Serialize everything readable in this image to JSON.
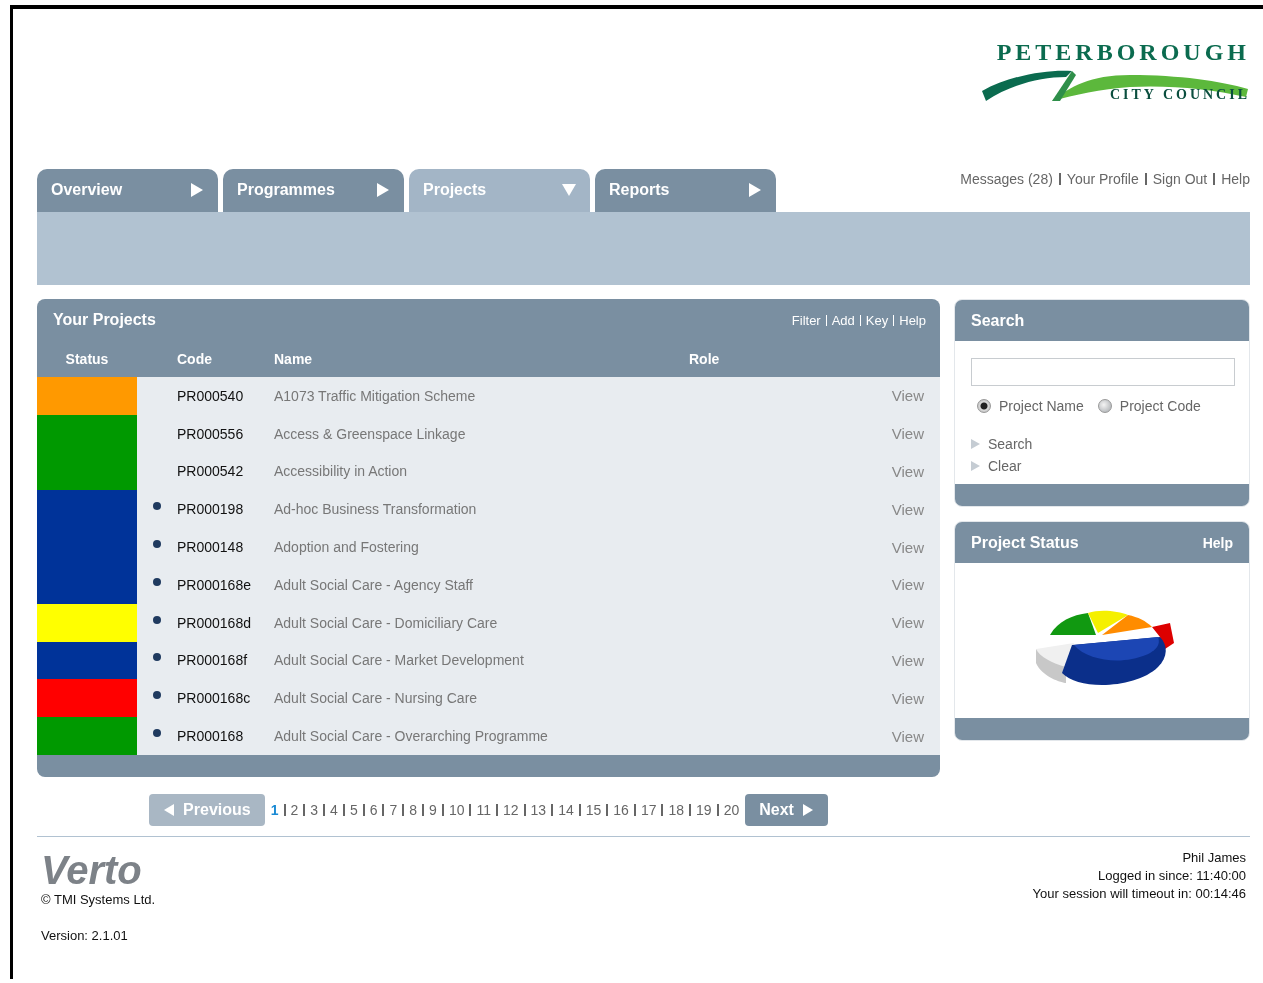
{
  "logo": {
    "title": "PETERBOROUGH",
    "subtitle": "CITY COUNCIL"
  },
  "tabs": [
    {
      "label": "Overview",
      "selected": false
    },
    {
      "label": "Programmes",
      "selected": false
    },
    {
      "label": "Projects",
      "selected": true
    },
    {
      "label": "Reports",
      "selected": false
    }
  ],
  "user_links": [
    "Messages (28)",
    "Your Profile",
    "Sign Out",
    "Help"
  ],
  "projects": {
    "title": "Your Projects",
    "actions": [
      "Filter",
      "Add",
      "Key",
      "Help"
    ],
    "columns": [
      "Status",
      "Code",
      "Name",
      "Role"
    ],
    "rows": [
      {
        "color": "#ff9900",
        "flagged": false,
        "code": "PR000540",
        "name": "A1073 Traffic Mitigation Scheme",
        "action": "View"
      },
      {
        "color": "#009900",
        "flagged": false,
        "code": "PR000556",
        "name": "Access & Greenspace Linkage",
        "action": "View"
      },
      {
        "color": "#009900",
        "flagged": false,
        "code": "PR000542",
        "name": "Accessibility in Action",
        "action": "View"
      },
      {
        "color": "#003399",
        "flagged": true,
        "code": "PR000198",
        "name": "Ad-hoc Business Transformation",
        "action": "View"
      },
      {
        "color": "#003399",
        "flagged": true,
        "code": "PR000148",
        "name": "Adoption and Fostering",
        "action": "View"
      },
      {
        "color": "#003399",
        "flagged": true,
        "code": "PR000168e",
        "name": "Adult Social Care - Agency Staff",
        "action": "View"
      },
      {
        "color": "#ffff00",
        "flagged": true,
        "code": "PR000168d",
        "name": "Adult Social Care - Domiciliary Care",
        "action": "View"
      },
      {
        "color": "#003399",
        "flagged": true,
        "code": "PR000168f",
        "name": "Adult Social Care - Market Development",
        "action": "View"
      },
      {
        "color": "#ff0000",
        "flagged": true,
        "code": "PR000168c",
        "name": "Adult Social Care - Nursing Care",
        "action": "View"
      },
      {
        "color": "#009900",
        "flagged": true,
        "code": "PR000168",
        "name": "Adult Social Care - Overarching Programme",
        "action": "View"
      }
    ]
  },
  "pagination": {
    "previous": {
      "label": "Previous",
      "disabled": true
    },
    "pages": [
      {
        "label": "1",
        "selected": true
      },
      {
        "label": "2",
        "selected": false
      },
      {
        "label": "3",
        "selected": false
      },
      {
        "label": "4",
        "selected": false
      },
      {
        "label": "5",
        "selected": false
      },
      {
        "label": "6",
        "selected": false
      },
      {
        "label": "7",
        "selected": false
      },
      {
        "label": "8",
        "selected": false
      },
      {
        "label": "9",
        "selected": false
      },
      {
        "label": "10",
        "selected": false
      },
      {
        "label": "11",
        "selected": false
      },
      {
        "label": "12",
        "selected": false
      },
      {
        "label": "13",
        "selected": false
      },
      {
        "label": "14",
        "selected": false
      },
      {
        "label": "15",
        "selected": false
      },
      {
        "label": "16",
        "selected": false
      },
      {
        "label": "17",
        "selected": false
      },
      {
        "label": "18",
        "selected": false
      },
      {
        "label": "19",
        "selected": false
      },
      {
        "label": "20",
        "selected": false
      }
    ],
    "next": {
      "label": "Next",
      "disabled": false
    }
  },
  "search": {
    "title": "Search",
    "options": [
      {
        "label": "Project Name",
        "selected": true
      },
      {
        "label": "Project Code",
        "selected": false
      }
    ],
    "links": [
      "Search",
      "Clear"
    ]
  },
  "status_panel": {
    "title": "Project Status",
    "help": "Help"
  },
  "footer": {
    "brand": "Verto",
    "copyright": "© TMI Systems Ltd.",
    "version": "Version: 2.1.01",
    "user": "Phil James",
    "logged_in": "Logged in since: 11:40:00",
    "timeout": "Your session will timeout in: 00:14:46"
  }
}
